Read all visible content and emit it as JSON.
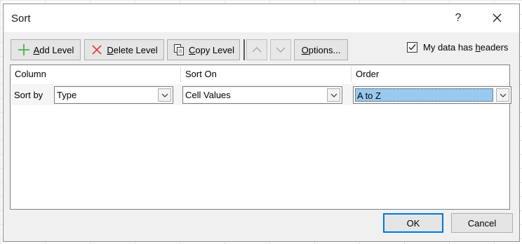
{
  "dialog": {
    "title": "Sort",
    "help_glyph": "?",
    "close_icon": "close-icon"
  },
  "toolbar": {
    "add_level": {
      "mnemonic": "A",
      "rest": "dd Level",
      "icon": "plus-icon",
      "icon_color": "#4caf50"
    },
    "delete_level": {
      "mnemonic": "D",
      "rest": "elete Level",
      "icon": "x-icon",
      "icon_color": "#e53935"
    },
    "copy_level": {
      "mnemonic": "C",
      "rest": "opy Level",
      "icon": "copy-icon"
    },
    "move_up_icon": "chevron-up-icon",
    "move_down_icon": "chevron-down-icon",
    "options": {
      "mnemonic": "O",
      "rest": "ptions..."
    },
    "headers_checkbox": {
      "before": "My data has ",
      "mnemonic": "h",
      "after": "eaders",
      "checked": true
    }
  },
  "grid": {
    "headers": {
      "column": "Column",
      "sort_on": "Sort On",
      "order": "Order"
    },
    "rows": [
      {
        "label": "Sort by",
        "column": "Type",
        "sort_on": "Cell Values",
        "order": "A to Z"
      }
    ]
  },
  "footer": {
    "ok": "OK",
    "cancel": "Cancel"
  },
  "colors": {
    "accent_border": "#0078d7",
    "selection": "#99c9ef"
  }
}
